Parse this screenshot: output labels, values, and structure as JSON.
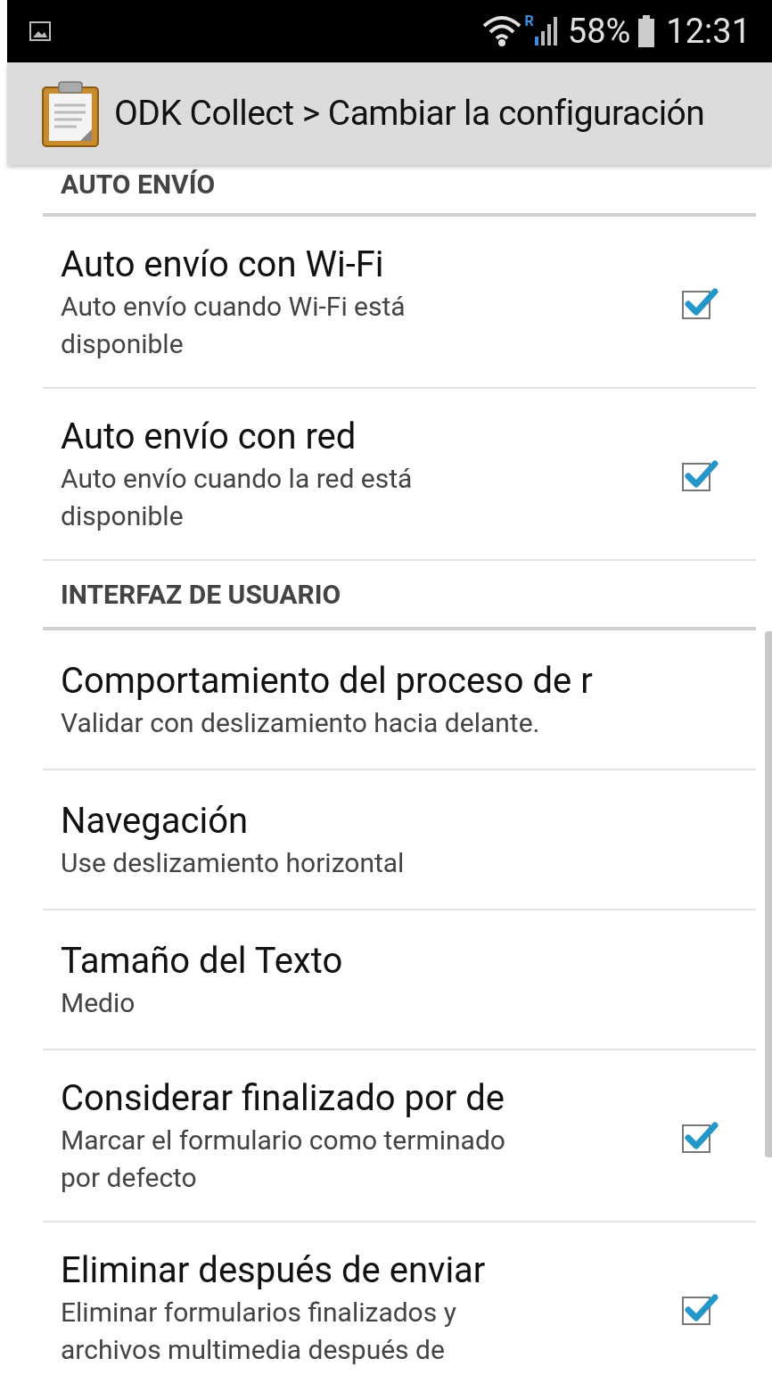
{
  "status_bar": {
    "battery": "58%",
    "time": "12:31",
    "roaming": "R"
  },
  "action_bar": {
    "title": "ODK Collect > Cambiar la configuración"
  },
  "sections": [
    {
      "title": "AUTO ENVÍO",
      "items": [
        {
          "kind": "checkbox",
          "title": "Auto envío con Wi-Fi",
          "summary": "Auto envío cuando Wi-Fi está disponible",
          "checked": true
        },
        {
          "kind": "checkbox",
          "title": "Auto envío con red",
          "summary": "Auto envío cuando la red está disponible",
          "checked": true
        }
      ]
    },
    {
      "title": "INTERFAZ DE USUARIO",
      "items": [
        {
          "kind": "list",
          "title": "Comportamiento del proceso de r",
          "summary": "Validar con deslizamiento hacia delante."
        },
        {
          "kind": "list",
          "title": "Navegación",
          "summary": "Use deslizamiento horizontal"
        },
        {
          "kind": "list",
          "title": "Tamaño del Texto",
          "summary": "Medio"
        },
        {
          "kind": "checkbox",
          "title": "Considerar finalizado por de",
          "summary": "Marcar el formulario como terminado por defecto",
          "checked": true
        },
        {
          "kind": "checkbox",
          "title": "Eliminar después de enviar",
          "summary": "Eliminar formularios finalizados y archivos multimedia después de",
          "checked": true
        }
      ]
    }
  ]
}
